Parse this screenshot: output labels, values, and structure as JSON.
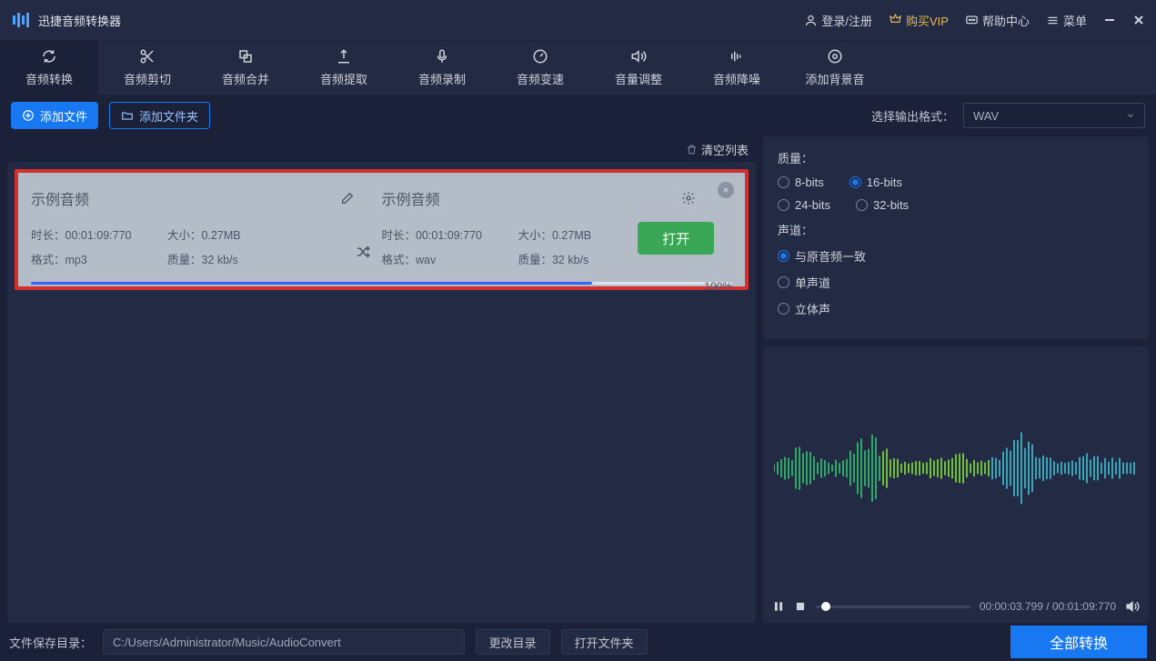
{
  "header": {
    "app_title": "迅捷音频转换器",
    "login": "登录/注册",
    "vip": "购买VIP",
    "help": "帮助中心",
    "menu": "菜单"
  },
  "tabs": [
    {
      "label": "音频转换"
    },
    {
      "label": "音频剪切"
    },
    {
      "label": "音频合并"
    },
    {
      "label": "音频提取"
    },
    {
      "label": "音频录制"
    },
    {
      "label": "音频变速"
    },
    {
      "label": "音量调整"
    },
    {
      "label": "音频降噪"
    },
    {
      "label": "添加背景音"
    }
  ],
  "toolbar": {
    "add_file": "添加文件",
    "add_folder": "添加文件夹",
    "output_format_label": "选择输出格式：",
    "output_format_value": "WAV"
  },
  "list": {
    "clear": "清空列表",
    "item": {
      "src_title": "示例音频",
      "dst_title": "示例音频",
      "src_duration": "时长：00:01:09:770",
      "src_size": "大小：0.27MB",
      "src_format": "格式：mp3",
      "src_quality": "质量：32 kb/s",
      "dst_duration": "时长：00:01:09:770",
      "dst_size": "大小：0.27MB",
      "dst_format": "格式：wav",
      "dst_quality": "质量：32 kb/s",
      "open": "打开",
      "progress": "100%"
    }
  },
  "quality": {
    "title": "质量：",
    "o1": "8-bits",
    "o2": "16-bits",
    "o3": "24-bits",
    "o4": "32-bits"
  },
  "channels": {
    "title": "声道：",
    "c1": "与原音频一致",
    "c2": "单声道",
    "c3": "立体声"
  },
  "player": {
    "current": "00:00:03.799",
    "total": "00:01:09:770"
  },
  "footer": {
    "save_label": "文件保存目录：",
    "save_path": "C:/Users/Administrator/Music/AudioConvert",
    "change_dir": "更改目录",
    "open_folder": "打开文件夹",
    "convert_all": "全部转换"
  }
}
